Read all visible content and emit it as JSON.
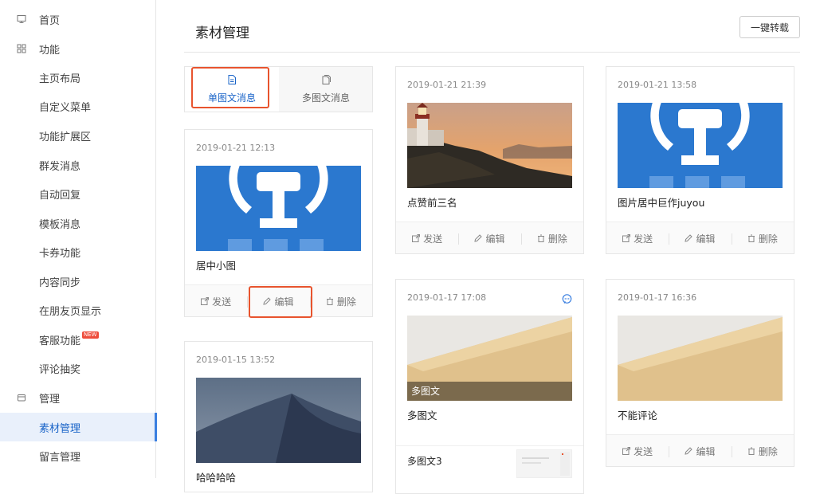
{
  "sidebar": {
    "groups": [
      {
        "label": "首页",
        "icon": "monitor-icon"
      },
      {
        "label": "功能",
        "icon": "grid-icon"
      },
      {
        "label": "管理",
        "icon": "folder-icon"
      }
    ],
    "items": [
      {
        "label": "主页布局"
      },
      {
        "label": "自定义菜单"
      },
      {
        "label": "功能扩展区"
      },
      {
        "label": "群发消息"
      },
      {
        "label": "自动回复"
      },
      {
        "label": "模板消息"
      },
      {
        "label": "卡券功能"
      },
      {
        "label": "内容同步"
      },
      {
        "label": "在朋友页显示"
      },
      {
        "label": "客服功能",
        "badge": "NEW"
      },
      {
        "label": "评论抽奖"
      }
    ],
    "manage_items": [
      {
        "label": "素材管理",
        "active": true
      },
      {
        "label": "留言管理"
      }
    ]
  },
  "header": {
    "title": "素材管理",
    "repost_button": "一键转载"
  },
  "tabs": [
    {
      "label": "单图文消息",
      "icon": "document-icon",
      "active": true
    },
    {
      "label": "多图文消息",
      "icon": "documents-icon",
      "active": false
    }
  ],
  "actions": {
    "send": "发送",
    "edit": "编辑",
    "delete": "删除"
  },
  "cards": [
    {
      "date": "2019-01-21 12:13",
      "title": "居中小图",
      "image": "railway-logo"
    },
    {
      "date": "2019-01-15 13:52",
      "title": "哈哈哈哈",
      "image": "dusk-dune"
    },
    {
      "date": "2019-01-21 21:39",
      "title": "点赞前三名",
      "image": "lighthouse"
    },
    {
      "date": "2019-01-17 17:08",
      "title": "多图文",
      "overlay": "多图文",
      "sub_title": "多图文3",
      "image": "sand-dune",
      "comment_icon": "comment-icon"
    },
    {
      "date": "2019-01-21 13:58",
      "title": "图片居中巨作juyou",
      "image": "railway-logo"
    },
    {
      "date": "2019-01-17 16:36",
      "title": "不能评论",
      "image": "sand-dune"
    }
  ],
  "colors": {
    "accent": "#1a64c8",
    "highlight": "#e8542e",
    "railway_blue": "#2b78cf"
  }
}
